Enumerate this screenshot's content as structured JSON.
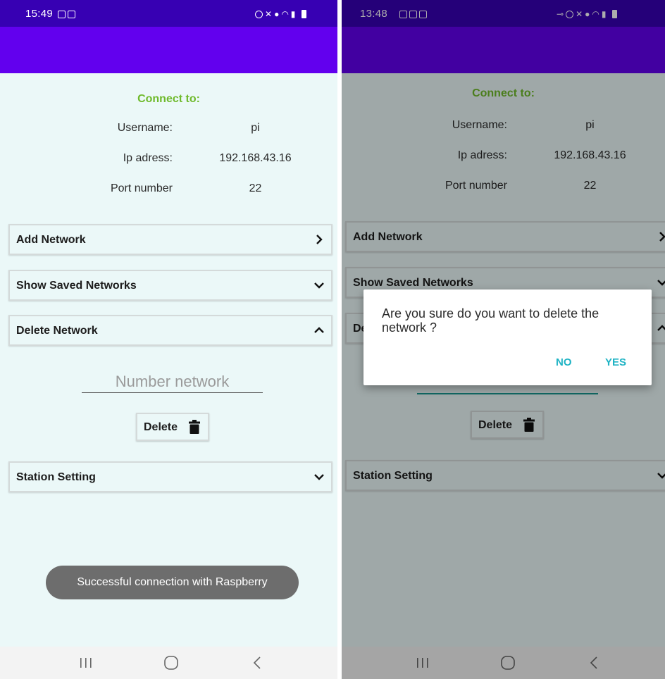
{
  "screens": [
    {
      "status": {
        "time": "15:49"
      },
      "form": {
        "connect_to": "Connect to:",
        "username_label": "Username:",
        "username_value": "pi",
        "ip_label": "Ip adress:",
        "ip_value": "192.168.43.16",
        "port_label": "Port number",
        "port_value": "22"
      },
      "sections": {
        "add_network": "Add Network",
        "show_saved": "Show Saved Networks",
        "delete_network": "Delete Network",
        "station_setting": "Station Setting"
      },
      "delete_panel": {
        "number_placeholder": "Number network",
        "delete_label": "Delete"
      },
      "toast": "Successful connection with Raspberry"
    },
    {
      "status": {
        "time": "13:48"
      },
      "form": {
        "connect_to": "Connect to:",
        "username_label": "Username:",
        "username_value": "pi",
        "ip_label": "Ip adress:",
        "ip_value": "192.168.43.16",
        "port_label": "Port number",
        "port_value": "22"
      },
      "sections": {
        "add_network": "Add Network",
        "show_saved": "Show Saved Networks",
        "delete_network_partial": "De",
        "station_setting": "Station Setting"
      },
      "delete_panel": {
        "delete_label": "Delete"
      },
      "dialog": {
        "message": "Are you sure do you want to delete the network ?",
        "no": "NO",
        "yes": "YES"
      }
    }
  ],
  "colors": {
    "appbar": "#6200ee",
    "statusbar": "#3700b3",
    "background": "#ebf8f8",
    "accent_green": "#6fba2c",
    "dialog_button": "#1fb3c4"
  },
  "icons": [
    "gallery-icon",
    "message-icon",
    "alarm-icon",
    "mute-icon",
    "location-icon",
    "wifi-icon",
    "signal-icon",
    "battery-icon",
    "chevron-right-icon",
    "chevron-down-icon",
    "chevron-up-icon",
    "trash-icon",
    "recent-apps-icon",
    "home-icon",
    "back-icon"
  ]
}
